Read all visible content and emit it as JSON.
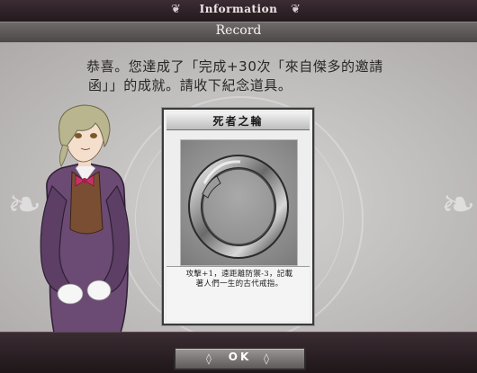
{
  "header": {
    "title": "Information",
    "subtitle": "Record"
  },
  "message": {
    "lines": [
      "恭喜。您達成了「完成+30次「來自傑多的邀請",
      "函」」的成就。請收下紀念道具。"
    ]
  },
  "item_card": {
    "name": "死者之輪",
    "icon": "ring-icon",
    "description": [
      "攻擊+1，遠距離防禦-3，記載",
      "著人們一生的古代戒指。"
    ]
  },
  "footer": {
    "ok_label": "OK"
  },
  "colors": {
    "header_bg": "#2c2126",
    "panel_bg": "#c9c6c6",
    "card_border": "#3a3a3a",
    "button_bg": "#7a7676"
  }
}
